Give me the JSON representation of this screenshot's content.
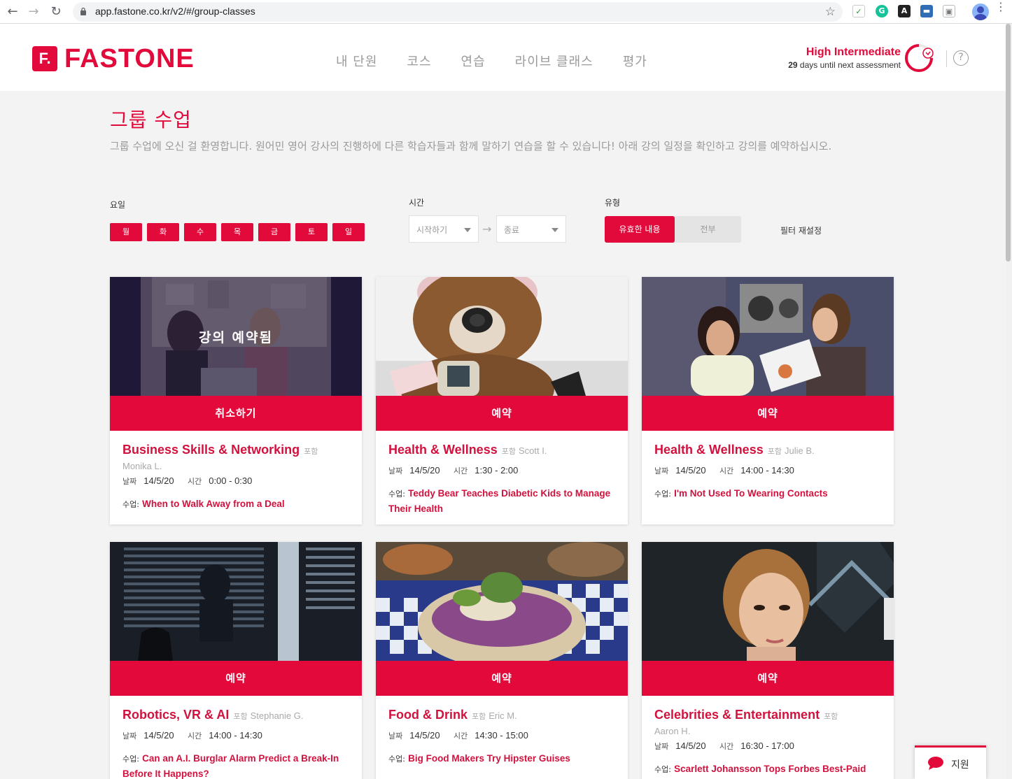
{
  "browser": {
    "url": "app.fastone.co.kr/v2/#/group-classes"
  },
  "header": {
    "logo_mark": "F.",
    "logo_text": "FASTONE",
    "nav": [
      "내 단원",
      "코스",
      "연습",
      "라이브 클래스",
      "평가"
    ],
    "level_title": "High Intermediate",
    "days_count": "29",
    "days_text": " days until next assessment",
    "help": "?"
  },
  "page": {
    "title": "그룹 수업",
    "description": "그룹 수업에 오신 걸 환영합니다. 원어민 영어 강사의 진행하에 다른 학습자들과 함께 말하기 연습을 할 수 있습니다! 아래 강의 일정을 확인하고 강의를 예약하십시오."
  },
  "filters": {
    "day_label": "요일",
    "days": [
      "월",
      "화",
      "수",
      "목",
      "금",
      "토",
      "일"
    ],
    "time_label": "시간",
    "start_placeholder": "시작하기",
    "end_placeholder": "종료",
    "type_label": "유형",
    "type_on": "유효한 내용",
    "type_off": "전부",
    "reset": "필터 재설정"
  },
  "labels": {
    "with": "포함",
    "date": "날짜",
    "time": "시간",
    "lesson": "수업:"
  },
  "cards": [
    {
      "button": "취소하기",
      "booked": "강의 예약됨",
      "title": "Business Skills & Networking",
      "teacher": "Monika L.",
      "date": "14/5/20",
      "time": "0:00 - 0:30",
      "lesson": "When to Walk Away from a Deal"
    },
    {
      "button": "예약",
      "title": "Health & Wellness",
      "teacher": "Scott I.",
      "date": "14/5/20",
      "time": "1:30 - 2:00",
      "lesson": "Teddy Bear Teaches Diabetic Kids to Manage Their Health"
    },
    {
      "button": "예약",
      "title": "Health & Wellness",
      "teacher": "Julie B.",
      "date": "14/5/20",
      "time": "14:00 - 14:30",
      "lesson": "I'm Not Used To Wearing Contacts"
    },
    {
      "button": "예약",
      "title": "Robotics, VR & AI",
      "teacher": "Stephanie G.",
      "date": "14/5/20",
      "time": "14:00 - 14:30",
      "lesson": "Can an A.I. Burglar Alarm Predict a Break-In Before It Happens?"
    },
    {
      "button": "예약",
      "title": "Food & Drink",
      "teacher": "Eric M.",
      "date": "14/5/20",
      "time": "14:30 - 15:00",
      "lesson": "Big Food Makers Try Hipster Guises"
    },
    {
      "button": "예약",
      "title": "Celebrities & Entertainment",
      "teacher": "Aaron H.",
      "date": "14/5/20",
      "time": "16:30 - 17:00",
      "lesson": "Scarlett Johansson Tops Forbes Best-Paid"
    }
  ],
  "support": {
    "label": "지원"
  },
  "colors": {
    "brand": "#e20a3b",
    "title_red": "#d2123e",
    "muted": "#9a9a9a",
    "background": "#f3f3f3"
  }
}
